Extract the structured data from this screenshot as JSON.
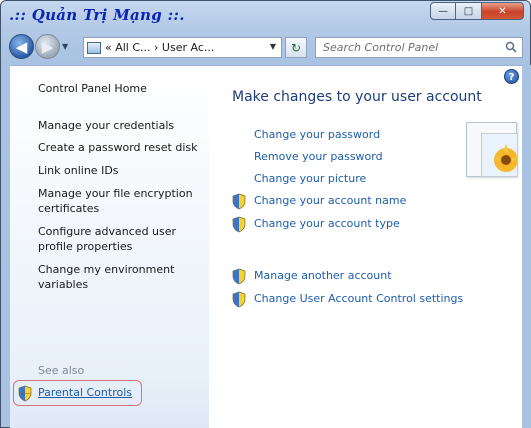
{
  "titlebar": {
    "watermark": ".:: Quản Trị Mạng ::.",
    "minimize_glyph": "—",
    "maximize_glyph": "□",
    "close_glyph": "✕"
  },
  "nav": {
    "back_glyph": "◀",
    "forward_glyph": "▶",
    "address_text": "« All C... › User Ac...",
    "search_placeholder": "Search Control Panel"
  },
  "sidebar": {
    "home": "Control Panel Home",
    "items": [
      "Manage your credentials",
      "Create a password reset disk",
      "Link online IDs",
      "Manage your file encryption certificates",
      "Configure advanced user profile properties",
      "Change my environment variables"
    ],
    "see_also": "See also",
    "parental_controls": "Parental Controls"
  },
  "main": {
    "heading": "Make changes to your user account",
    "links": [
      "Change your password",
      "Remove your password",
      "Change your picture",
      "Change your account name",
      "Change your account type"
    ],
    "links2": [
      "Manage another account",
      "Change User Account Control settings"
    ],
    "help_glyph": "?"
  },
  "colors": {
    "link": "#1d5dab",
    "heading": "#1f3d7a",
    "highlight_border": "#d9737c"
  }
}
